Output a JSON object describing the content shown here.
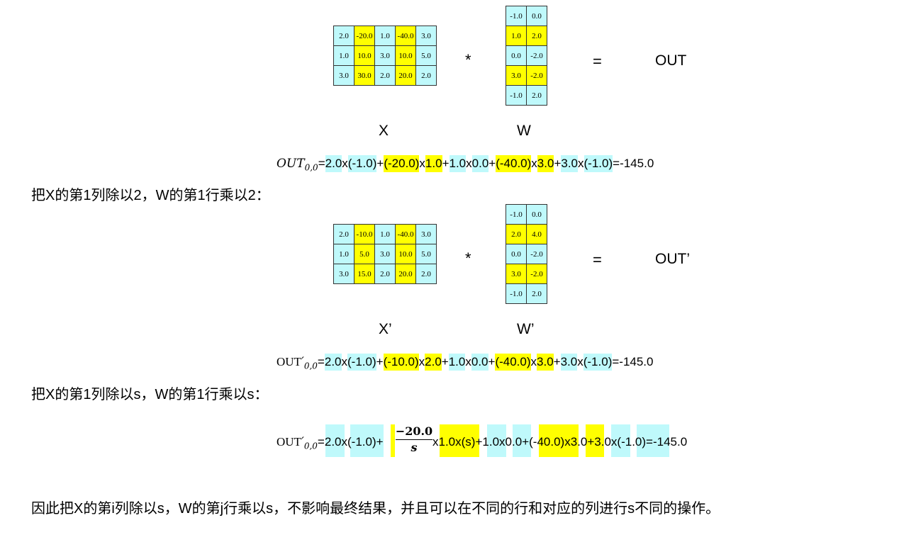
{
  "x_matrix": [
    [
      "2.0",
      "-20.0",
      "1.0",
      "-40.0",
      "3.0"
    ],
    [
      "1.0",
      "10.0",
      "3.0",
      "10.0",
      "5.0"
    ],
    [
      "3.0",
      "30.0",
      "2.0",
      "20.0",
      "2.0"
    ]
  ],
  "w_matrix": [
    [
      "-1.0",
      "0.0"
    ],
    [
      "1.0",
      "2.0"
    ],
    [
      "0.0",
      "-2.0"
    ],
    [
      "3.0",
      "-2.0"
    ],
    [
      "-1.0",
      "2.0"
    ]
  ],
  "x2_matrix": [
    [
      "2.0",
      "-10.0",
      "1.0",
      "-40.0",
      "3.0"
    ],
    [
      "1.0",
      "5.0",
      "3.0",
      "10.0",
      "5.0"
    ],
    [
      "3.0",
      "15.0",
      "2.0",
      "20.0",
      "2.0"
    ]
  ],
  "w2_matrix": [
    [
      "-1.0",
      "0.0"
    ],
    [
      "2.0",
      "4.0"
    ],
    [
      "0.0",
      "-2.0"
    ],
    [
      "3.0",
      "-2.0"
    ],
    [
      "-1.0",
      "2.0"
    ]
  ],
  "symbols": {
    "times": "*",
    "equals": "=",
    "out": "OUT",
    "out_prime": "OUT’",
    "x": "X",
    "w": "W",
    "x_prime": "X’",
    "w_prime": "W’"
  },
  "eq1": {
    "lhs": "OUT",
    "sub": "0,0",
    "parts": [
      "2.0",
      "x",
      "(-1.0)",
      "+",
      "(-20.0)",
      "x",
      "1.0",
      "+",
      "1.0",
      "x",
      "0.0",
      "+",
      "(-40.0)",
      "x",
      "3.0",
      "+",
      "3.0",
      "x",
      "(-1.0)",
      "=-145.0"
    ]
  },
  "eq2": {
    "lhs": "OUT",
    "prime": "′",
    "sub": "0,0",
    "parts": [
      "2.0",
      "x",
      "(-1.0)",
      "+",
      "(-10.0)",
      "x",
      "2.0",
      "+",
      "1.0",
      "x",
      "0.0",
      "+",
      "(-40.0)",
      "x",
      "3.0",
      "+",
      "3.0",
      "x",
      "(-1.0)",
      "=-145.0"
    ]
  },
  "eq3": {
    "lhs": "OUT",
    "prime": "′",
    "sub": "0,0",
    "parts": [
      "2.0",
      "x",
      "(-1.0)",
      "+"
    ],
    "frac_num": "−20.0",
    "frac_den": "s",
    "parts2": [
      "x",
      "1.0",
      "x",
      "(s)",
      "+",
      "1.0",
      "x",
      "0.0",
      "+",
      "(-40.0)",
      "x",
      "3.0",
      "+",
      "3.0",
      "x",
      "(-1.0)",
      "=-145.0"
    ]
  },
  "text": {
    "line1": "把X的第1列除以2，W的第1行乘以2：",
    "line2": "把X的第1列除以s，W的第1行乘以s：",
    "line3": "因此把X的第i列除以s，W的第j行乘以s，不影响最终结果，并且可以在不同的行和对应的列进行s不同的操作。"
  }
}
